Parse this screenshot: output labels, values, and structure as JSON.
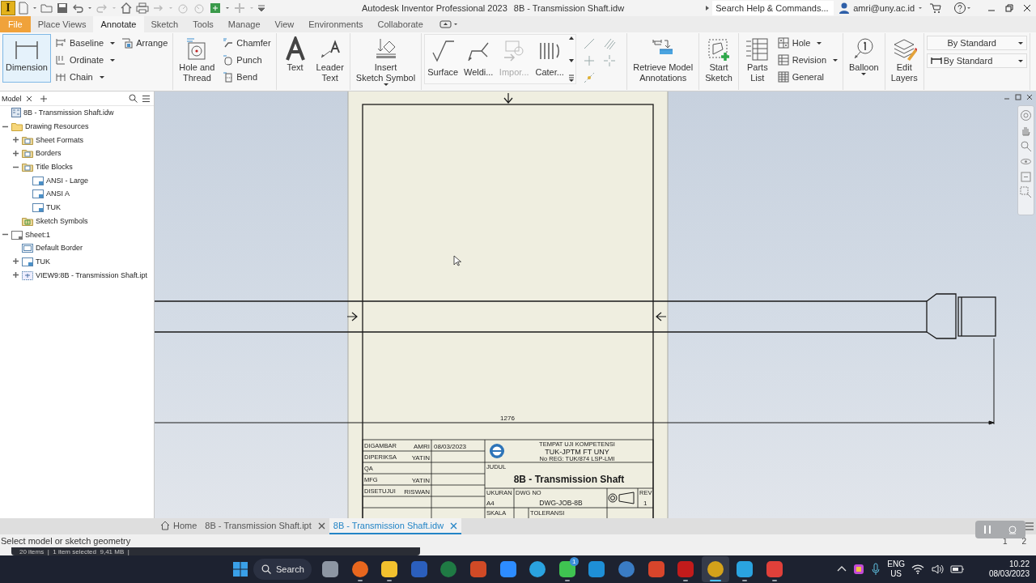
{
  "title_bar": {
    "logo": "I",
    "app_title": "Autodesk Inventor Professional 2023",
    "document_title": "8B - Transmission Shaft.idw",
    "search": {
      "placeholder": "Search Help & Commands..."
    },
    "user": "amri@uny.ac.id"
  },
  "ribbon_tabs": [
    {
      "label": "File",
      "kind": "file",
      "selected": false
    },
    {
      "label": "Place Views",
      "kind": "tab",
      "selected": false
    },
    {
      "label": "Annotate",
      "kind": "tab",
      "selected": true
    },
    {
      "label": "Sketch",
      "kind": "tab",
      "selected": false
    },
    {
      "label": "Tools",
      "kind": "tab",
      "selected": false
    },
    {
      "label": "Manage",
      "kind": "tab",
      "selected": false
    },
    {
      "label": "View",
      "kind": "tab",
      "selected": false
    },
    {
      "label": "Environments",
      "kind": "tab",
      "selected": false
    },
    {
      "label": "Collaborate",
      "kind": "tab",
      "selected": false
    }
  ],
  "ribbon_groups": [
    {
      "columns": [
        {
          "kind": "large",
          "label": "Dimension",
          "selected": true,
          "dropdown": false
        },
        {
          "kind": "stack",
          "items": [
            {
              "label": "Baseline",
              "dropdown": true
            },
            {
              "label": "Ordinate",
              "dropdown": true
            },
            {
              "label": "Chain",
              "dropdown": true
            }
          ]
        },
        {
          "kind": "stack",
          "items": [
            {
              "label": "Arrange",
              "dropdown": false
            }
          ]
        }
      ]
    },
    {
      "columns": [
        {
          "kind": "large",
          "label": "Hole and\nThread",
          "selected": false,
          "dropdown": false
        },
        {
          "kind": "stack",
          "items": [
            {
              "label": "Chamfer",
              "dropdown": false
            },
            {
              "label": "Punch",
              "dropdown": false
            },
            {
              "label": "Bend",
              "dropdown": false
            }
          ]
        }
      ]
    },
    {
      "columns": [
        {
          "kind": "large",
          "label": "Text",
          "selected": false,
          "dropdown": false
        },
        {
          "kind": "large",
          "label": "Leader\nText",
          "selected": false,
          "dropdown": false
        }
      ]
    },
    {
      "columns": [
        {
          "kind": "large",
          "label": "Insert\nSketch Symbol",
          "selected": false,
          "dropdown": true
        }
      ]
    },
    {
      "columns": [
        {
          "kind": "gallery",
          "items": [
            {
              "label": "Surface",
              "disabled": false
            },
            {
              "label": "Weldi...",
              "disabled": false
            },
            {
              "label": "Impor...",
              "disabled": true
            },
            {
              "label": "Cater...",
              "disabled": false
            }
          ]
        },
        {
          "kind": "icons"
        }
      ]
    },
    {
      "columns": [
        {
          "kind": "large",
          "label": "Retrieve Model\nAnnotations",
          "selected": false,
          "dropdown": false
        }
      ]
    },
    {
      "columns": [
        {
          "kind": "large",
          "label": "Start\nSketch",
          "selected": false,
          "dropdown": false
        }
      ]
    },
    {
      "columns": [
        {
          "kind": "large",
          "label": "Parts\nList",
          "selected": false,
          "dropdown": false
        },
        {
          "kind": "stack",
          "items": [
            {
              "label": "Hole",
              "dropdown": true
            },
            {
              "label": "Revision",
              "dropdown": true
            },
            {
              "label": "General",
              "dropdown": false
            }
          ]
        }
      ]
    },
    {
      "columns": [
        {
          "kind": "large",
          "label": "Balloon",
          "selected": false,
          "dropdown": true
        }
      ]
    },
    {
      "columns": [
        {
          "kind": "large",
          "label": "Edit\nLayers",
          "selected": false,
          "dropdown": false
        }
      ]
    },
    {
      "columns": [
        {
          "kind": "selects",
          "items": [
            {
              "value": "By Standard",
              "icon": false
            },
            {
              "value": "By Standard",
              "icon": true
            }
          ]
        }
      ]
    }
  ],
  "browser": {
    "tab": "Model",
    "tree": [
      {
        "label": "8B - Transmission Shaft.idw",
        "kind": "document"
      },
      {
        "label": "Drawing Resources",
        "kind": "folder",
        "expanded": true,
        "children": [
          {
            "label": "Sheet Formats",
            "kind": "resource-folder",
            "expanded": false
          },
          {
            "label": "Borders",
            "kind": "resource-folder",
            "expanded": false
          },
          {
            "label": "Title Blocks",
            "kind": "resource-folder",
            "expanded": true,
            "children": [
              {
                "label": "ANSI - Large",
                "kind": "template"
              },
              {
                "label": "ANSI A",
                "kind": "template"
              },
              {
                "label": "TUK",
                "kind": "template"
              }
            ]
          },
          {
            "label": "Sketch Symbols",
            "kind": "symbols"
          }
        ]
      },
      {
        "label": "Sheet:1",
        "kind": "sheet",
        "expanded": true,
        "children": [
          {
            "label": "Default Border",
            "kind": "border"
          },
          {
            "label": "TUK",
            "kind": "template",
            "expanded": false
          },
          {
            "label": "VIEW9:8B - Transmission Shaft.ipt",
            "kind": "view",
            "expanded": false
          }
        ]
      }
    ]
  },
  "drawing": {
    "dimension": "1276",
    "title_block": {
      "signoffs": [
        {
          "role": "DIGAMBAR",
          "name": "AMRI",
          "date": "08/03/2023"
        },
        {
          "role": "DIPERIKSA",
          "name": "YATIN"
        },
        {
          "role": "QA"
        },
        {
          "role": "MFG",
          "name": "YATIN"
        },
        {
          "role": "DISETUJUI",
          "name": "RISWAN"
        }
      ],
      "organization": [
        "TEMPAT UJI KOMPETENSI",
        "TUK-JPTM FT UNY",
        "No REG: TUK/874 LSP-LMI"
      ],
      "title_label": "JUDUL",
      "title": "8B - Transmission Shaft",
      "size_label": "UKURAN",
      "size": "A4",
      "dwg_no_label": "DWG NO",
      "dwg_no": "DWG-JOB-8B",
      "rev_label": "REV",
      "rev": "1",
      "scale_label": "SKALA",
      "tolerance_label": "TOLERANSI"
    }
  },
  "document_tabs": [
    {
      "label": "Home",
      "kind": "home",
      "selected": false
    },
    {
      "label": "8B - Transmission Shaft.ipt",
      "kind": "document",
      "selected": false
    },
    {
      "label": "8B - Transmission Shaft.idw",
      "kind": "document",
      "selected": true
    }
  ],
  "status_bar": {
    "message": "Select model or sketch geometry",
    "pages": [
      "1",
      "2"
    ]
  },
  "explorer_status": "20 items  |  1 item selected  9,41 MB  |",
  "taskbar": {
    "search": "Search",
    "apps": [
      {
        "color": "#8d96a3",
        "running": false,
        "selected": false
      },
      {
        "color": "#e8671e",
        "running": true,
        "selected": false
      },
      {
        "color": "#f2c12e",
        "running": true,
        "selected": false
      },
      {
        "color": "#2b5fbd",
        "running": false,
        "selected": false
      },
      {
        "color": "#1f7a44",
        "running": false,
        "selected": false
      },
      {
        "color": "#d04a26",
        "running": false,
        "selected": false
      },
      {
        "color": "#2d8cff",
        "running": false,
        "selected": false
      },
      {
        "color": "#2aa3e0",
        "running": false,
        "selected": false
      },
      {
        "color": "#3fc351",
        "running": true,
        "selected": false,
        "badge": "1"
      },
      {
        "color": "#1e8fd6",
        "running": false,
        "selected": false
      },
      {
        "color": "#3a7cc4",
        "running": false,
        "selected": false
      },
      {
        "color": "#d8452b",
        "running": false,
        "selected": false
      },
      {
        "color": "#c21b1b",
        "running": true,
        "selected": false
      },
      {
        "color": "#d4a21a",
        "running": true,
        "selected": true
      },
      {
        "color": "#2aa3e0",
        "running": true,
        "selected": false
      },
      {
        "color": "#e0403a",
        "running": true,
        "selected": false
      }
    ],
    "language": "ENG",
    "region": "US",
    "time": "10.22",
    "date": "08/03/2023"
  }
}
